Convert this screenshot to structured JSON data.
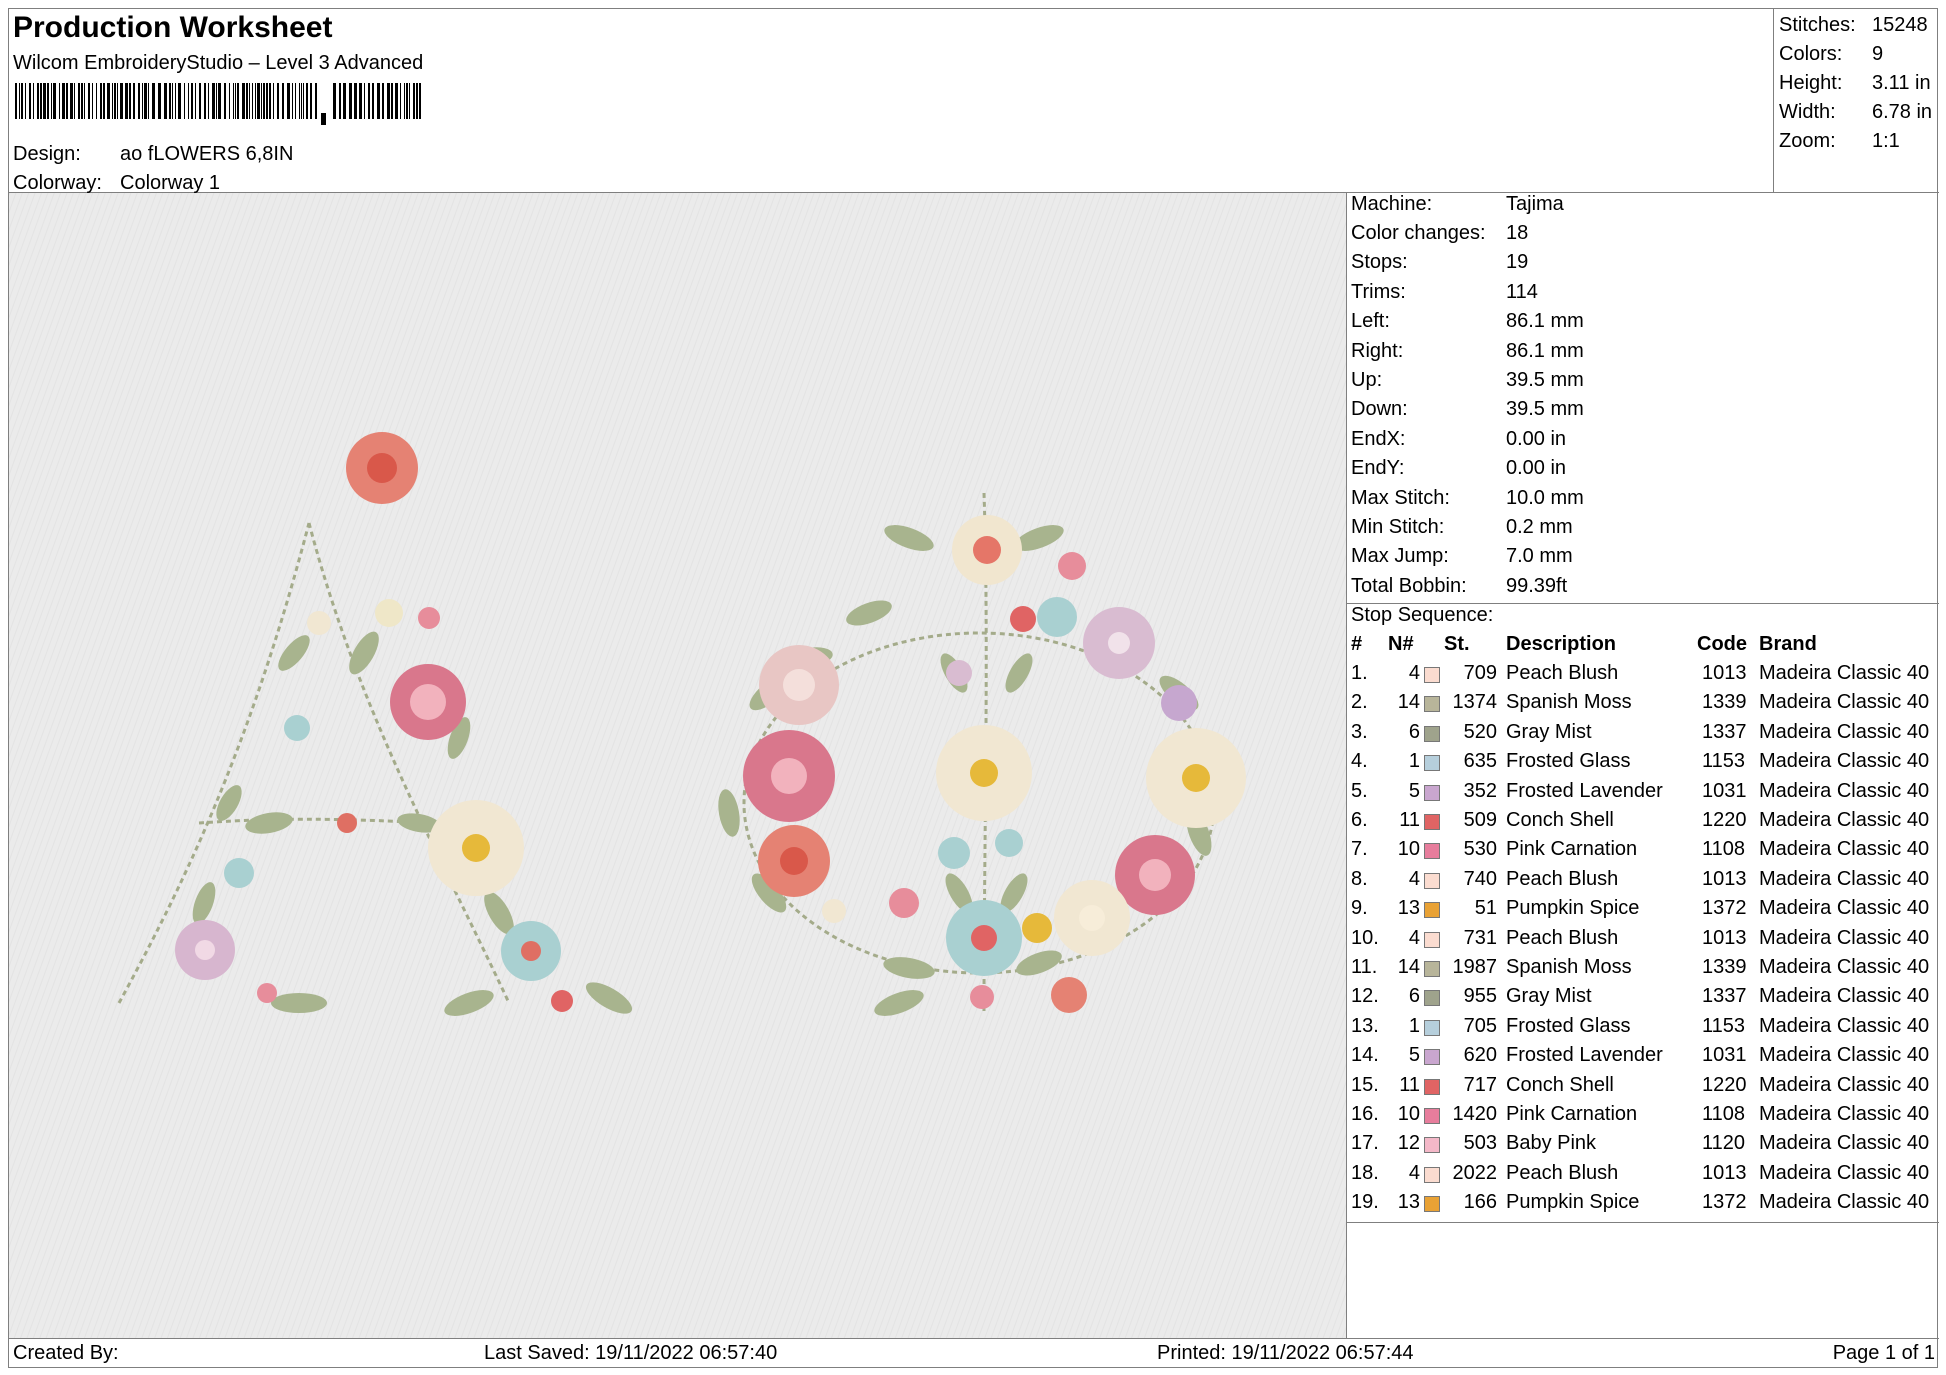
{
  "header": {
    "title": "Production Worksheet",
    "software": "Wilcom EmbroideryStudio – Level 3 Advanced",
    "design_label": "Design:",
    "design_value": "ao fLOWERS 6,8IN",
    "colorway_label": "Colorway:",
    "colorway_value": "Colorway 1"
  },
  "summary": [
    {
      "label": "Stitches:",
      "value": "15248"
    },
    {
      "label": "Colors:",
      "value": "9"
    },
    {
      "label": "Height:",
      "value": "3.11 in"
    },
    {
      "label": "Width:",
      "value": "6.78 in"
    },
    {
      "label": "Zoom:",
      "value": "1:1"
    }
  ],
  "machine_info": [
    {
      "label": "Machine:",
      "value": "Tajima"
    },
    {
      "label": "Color changes:",
      "value": "18"
    },
    {
      "label": "Stops:",
      "value": "19"
    },
    {
      "label": "Trims:",
      "value": "114"
    },
    {
      "label": "Left:",
      "value": "86.1 mm"
    },
    {
      "label": "Right:",
      "value": "86.1 mm"
    },
    {
      "label": "Up:",
      "value": "39.5 mm"
    },
    {
      "label": "Down:",
      "value": "39.5 mm"
    },
    {
      "label": "EndX:",
      "value": "0.00 in"
    },
    {
      "label": "EndY:",
      "value": "0.00 in"
    },
    {
      "label": "Max Stitch:",
      "value": "10.0 mm"
    },
    {
      "label": "Min Stitch:",
      "value": "0.2 mm"
    },
    {
      "label": "Max Jump:",
      "value": "7.0 mm"
    },
    {
      "label": "Total Bobbin:",
      "value": "99.39ft"
    }
  ],
  "stop_sequence": {
    "title": "Stop Sequence:",
    "columns": {
      "index": "#",
      "needle": "N#",
      "stitches": "St.",
      "description": "Description",
      "code": "Code",
      "brand": "Brand"
    },
    "rows": [
      {
        "index": "1.",
        "needle": "4",
        "color": "#fbdcd0",
        "stitches": "709",
        "description": "Peach Blush",
        "code": "1013",
        "brand": "Madeira Classic 40"
      },
      {
        "index": "2.",
        "needle": "14",
        "color": "#b8b59a",
        "stitches": "1374",
        "description": "Spanish Moss",
        "code": "1339",
        "brand": "Madeira Classic 40"
      },
      {
        "index": "3.",
        "needle": "6",
        "color": "#9fa38c",
        "stitches": "520",
        "description": "Gray Mist",
        "code": "1337",
        "brand": "Madeira Classic 40"
      },
      {
        "index": "4.",
        "needle": "1",
        "color": "#b6cfdc",
        "stitches": "635",
        "description": "Frosted Glass",
        "code": "1153",
        "brand": "Madeira Classic 40"
      },
      {
        "index": "5.",
        "needle": "5",
        "color": "#c9a6cf",
        "stitches": "352",
        "description": "Frosted Lavender",
        "code": "1031",
        "brand": "Madeira Classic 40"
      },
      {
        "index": "6.",
        "needle": "11",
        "color": "#e06464",
        "stitches": "509",
        "description": "Conch Shell",
        "code": "1220",
        "brand": "Madeira Classic 40"
      },
      {
        "index": "7.",
        "needle": "10",
        "color": "#e77d9c",
        "stitches": "530",
        "description": "Pink Carnation",
        "code": "1108",
        "brand": "Madeira Classic 40"
      },
      {
        "index": "8.",
        "needle": "4",
        "color": "#fbdcd0",
        "stitches": "740",
        "description": "Peach Blush",
        "code": "1013",
        "brand": "Madeira Classic 40"
      },
      {
        "index": "9.",
        "needle": "13",
        "color": "#e9a235",
        "stitches": "51",
        "description": "Pumpkin Spice",
        "code": "1372",
        "brand": "Madeira Classic 40"
      },
      {
        "index": "10.",
        "needle": "4",
        "color": "#fbdcd0",
        "stitches": "731",
        "description": "Peach Blush",
        "code": "1013",
        "brand": "Madeira Classic 40"
      },
      {
        "index": "11.",
        "needle": "14",
        "color": "#b8b59a",
        "stitches": "1987",
        "description": "Spanish Moss",
        "code": "1339",
        "brand": "Madeira Classic 40"
      },
      {
        "index": "12.",
        "needle": "6",
        "color": "#9fa38c",
        "stitches": "955",
        "description": "Gray Mist",
        "code": "1337",
        "brand": "Madeira Classic 40"
      },
      {
        "index": "13.",
        "needle": "1",
        "color": "#b6cfdc",
        "stitches": "705",
        "description": "Frosted Glass",
        "code": "1153",
        "brand": "Madeira Classic 40"
      },
      {
        "index": "14.",
        "needle": "5",
        "color": "#c9a6cf",
        "stitches": "620",
        "description": "Frosted Lavender",
        "code": "1031",
        "brand": "Madeira Classic 40"
      },
      {
        "index": "15.",
        "needle": "11",
        "color": "#e06464",
        "stitches": "717",
        "description": "Conch Shell",
        "code": "1220",
        "brand": "Madeira Classic 40"
      },
      {
        "index": "16.",
        "needle": "10",
        "color": "#e77d9c",
        "stitches": "1420",
        "description": "Pink Carnation",
        "code": "1108",
        "brand": "Madeira Classic 40"
      },
      {
        "index": "17.",
        "needle": "12",
        "color": "#f4b8c8",
        "stitches": "503",
        "description": "Baby Pink",
        "code": "1120",
        "brand": "Madeira Classic 40"
      },
      {
        "index": "18.",
        "needle": "4",
        "color": "#fbdcd0",
        "stitches": "2022",
        "description": "Peach Blush",
        "code": "1013",
        "brand": "Madeira Classic 40"
      },
      {
        "index": "19.",
        "needle": "13",
        "color": "#e9a235",
        "stitches": "166",
        "description": "Pumpkin Spice",
        "code": "1372",
        "brand": "Madeira Classic 40"
      }
    ]
  },
  "footer": {
    "created_by": "Created By:",
    "last_saved": "Last Saved: 19/11/2022 06:57:40",
    "printed": "Printed: 19/11/2022 06:57:44",
    "page": "Page 1 of 1"
  }
}
